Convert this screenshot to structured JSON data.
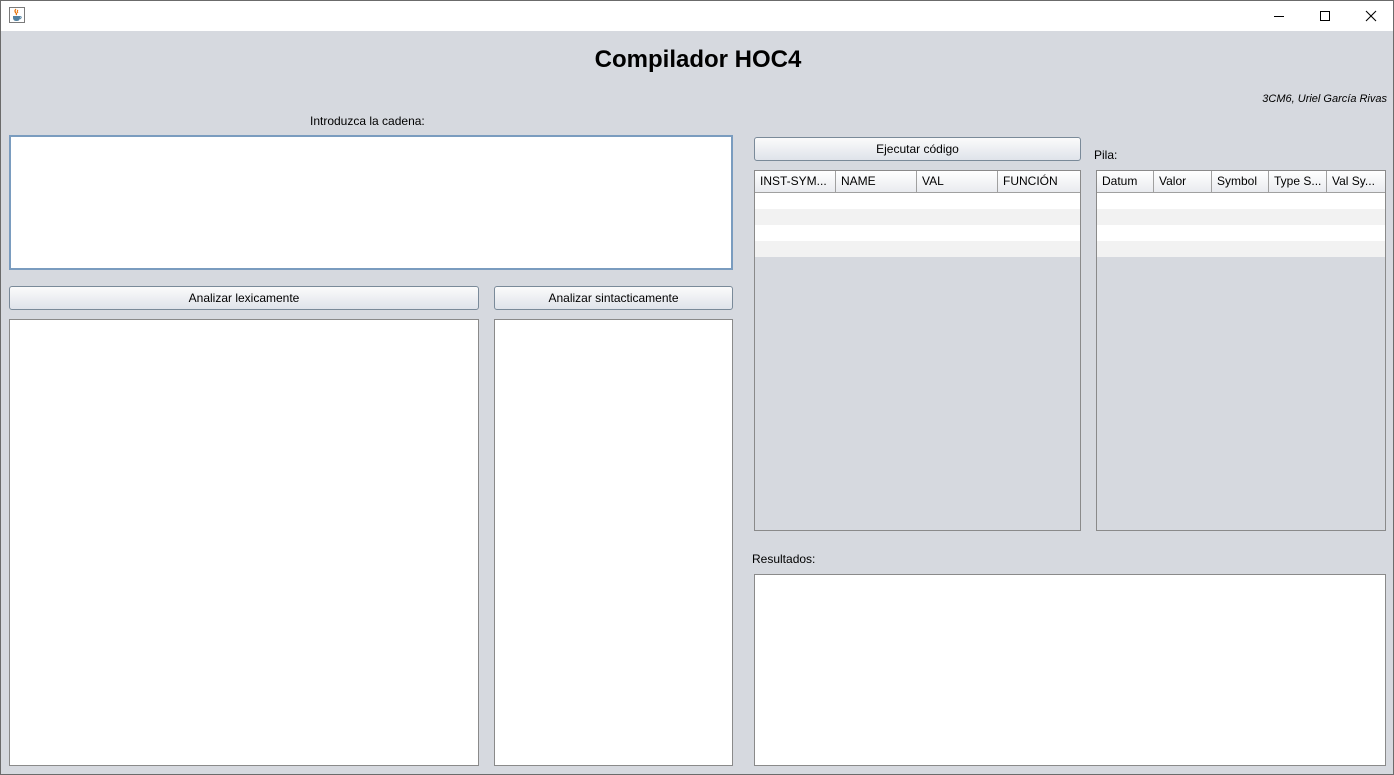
{
  "window": {
    "icon": "java-cup-icon",
    "controls": [
      "minimize-icon",
      "maximize-icon",
      "close-icon"
    ]
  },
  "header": {
    "title": "Compilador HOC4",
    "author": "3CM6, Uriel García Rivas"
  },
  "input": {
    "label": "Introduzca la cadena:",
    "value": ""
  },
  "buttons": {
    "lexical": "Analizar lexicamente",
    "syntactic": "Analizar sintacticamente",
    "execute": "Ejecutar código"
  },
  "symbols_table": {
    "columns": [
      "INST-SYM...",
      "NAME",
      "VAL",
      "FUNCIÓN"
    ],
    "rows": []
  },
  "stack": {
    "label": "Pila:",
    "columns": [
      "Datum",
      "Valor",
      "Symbol",
      "Type S...",
      "Val Sy..."
    ],
    "rows": []
  },
  "results": {
    "label": "Resultados:",
    "value": ""
  },
  "colors": {
    "background": "#d6d9df",
    "input_border": "#7a9cbf"
  }
}
